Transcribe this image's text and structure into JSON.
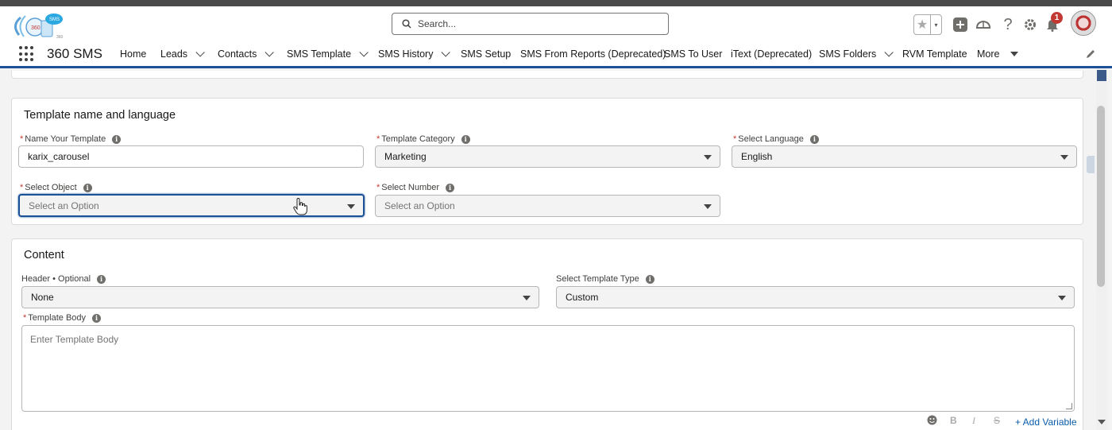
{
  "header": {
    "search_placeholder": "Search...",
    "notification_count": "1"
  },
  "nav": {
    "app_name": "360 SMS",
    "items": [
      {
        "label": "Home",
        "dropdown": false
      },
      {
        "label": "Leads",
        "dropdown": true
      },
      {
        "label": "Contacts",
        "dropdown": true
      },
      {
        "label": "SMS Template",
        "dropdown": true
      },
      {
        "label": "SMS History",
        "dropdown": true
      },
      {
        "label": "SMS Setup",
        "dropdown": false
      },
      {
        "label": "SMS From Reports (Deprecated)",
        "dropdown": false
      },
      {
        "label": "SMS To User",
        "dropdown": false
      },
      {
        "label": "iText (Deprecated)",
        "dropdown": false
      },
      {
        "label": "SMS Folders",
        "dropdown": true
      },
      {
        "label": "RVM Template",
        "dropdown": false
      },
      {
        "label": "More",
        "dropdown": true
      }
    ]
  },
  "template_card": {
    "title": "Template name and language",
    "name_label": "Name Your Template",
    "name_value": "karix_carousel",
    "category_label": "Template Category",
    "category_value": "Marketing",
    "language_label": "Select Language",
    "language_value": "English",
    "object_label": "Select Object",
    "object_placeholder": "Select an Option",
    "number_label": "Select Number",
    "number_placeholder": "Select an Option"
  },
  "content_card": {
    "title": "Content",
    "header_label": "Header • Optional",
    "header_value": "None",
    "type_label": "Select Template Type",
    "type_value": "Custom",
    "body_label": "Template Body",
    "body_placeholder": "Enter Template Body",
    "add_variable": "+ Add Variable"
  },
  "colors": {
    "brand_blue": "#1b5297",
    "required_red": "#c23934",
    "link_blue": "#0b5cab"
  }
}
